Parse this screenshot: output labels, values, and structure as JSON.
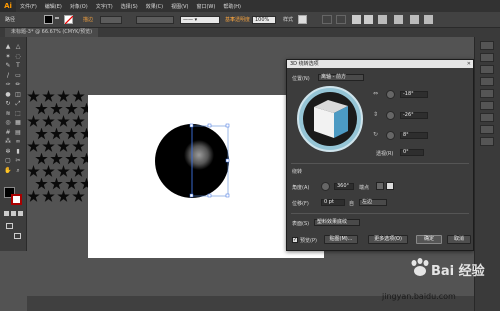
{
  "app": {
    "logo": "Ai"
  },
  "menubar": {
    "items": [
      "文件(F)",
      "编辑(E)",
      "对象(O)",
      "文字(T)",
      "选择(S)",
      "效果(C)",
      "视图(V)",
      "窗口(W)",
      "帮助(H)"
    ]
  },
  "control_bar": {
    "path_label": "路径",
    "stroke_label": "描边",
    "opacity_label": "不透明度",
    "opacity_value": "100%",
    "style_label": "样式",
    "basic_label": "基本",
    "colors": {
      "fill": "#000000",
      "stroke": "#ffffff"
    }
  },
  "document": {
    "tab_title": "未标题-3* @ 66.67% (CMYK/预览)"
  },
  "toolbar": {
    "icons": [
      "selection-tool-icon",
      "direct-selection-tool-icon",
      "magic-wand-icon",
      "lasso-icon",
      "pen-tool-icon",
      "type-tool-icon",
      "line-tool-icon",
      "rectangle-tool-icon",
      "paintbrush-icon",
      "pencil-icon",
      "blob-brush-icon",
      "eraser-icon",
      "rotate-tool-icon",
      "scale-tool-icon",
      "width-tool-icon",
      "free-transform-icon",
      "shape-builder-icon",
      "perspective-grid-icon",
      "mesh-tool-icon",
      "gradient-tool-icon",
      "eyedropper-icon",
      "blend-tool-icon",
      "symbol-sprayer-icon",
      "column-graph-icon",
      "artboard-tool-icon",
      "slice-tool-icon",
      "hand-tool-icon",
      "zoom-tool-icon"
    ]
  },
  "dialog": {
    "title": "3D 绕转选项",
    "position_label": "位置(N)",
    "position_value": "离轴 - 前方",
    "rot_x": "-18°",
    "rot_y": "-26°",
    "rot_z": "8°",
    "perspective_label": "透视(R)",
    "perspective_value": "0°",
    "revolve_section": "绕转",
    "angle_label": "角度(A)",
    "angle_value": "360°",
    "cap_label": "端点",
    "offset_label": "位移(F)",
    "offset_value": "0 pt",
    "from_label": "自",
    "from_value": "左边",
    "surface_label": "表面(S)",
    "surface_value": "塑料效果底纹",
    "preview_label": "预览(P)",
    "map_button": "贴图(M)...",
    "more_button": "更多选项(O)",
    "ok_button": "确定",
    "cancel_button": "取消"
  },
  "watermark": {
    "brand": "Bai 经验",
    "url": "jingyan.baidu.com"
  }
}
